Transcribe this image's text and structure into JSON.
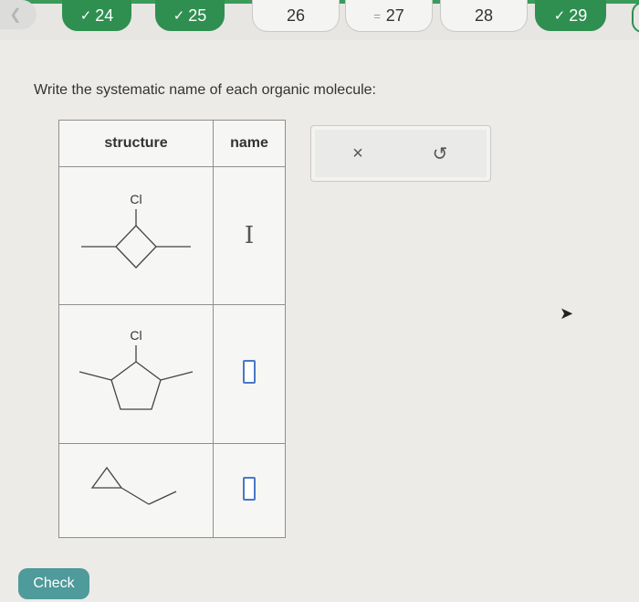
{
  "nav": {
    "back_icon": "chevron-left-icon",
    "questions": [
      {
        "label": "24",
        "status": "done"
      },
      {
        "label": "25",
        "status": "done"
      },
      {
        "label": "26",
        "status": "todo"
      },
      {
        "label": "27",
        "status": "current"
      },
      {
        "label": "28",
        "status": "todo"
      },
      {
        "label": "29",
        "status": "done"
      }
    ],
    "check_glyph": "✓",
    "current_glyph": "="
  },
  "prompt": "Write the systematic name of each organic molecule:",
  "table": {
    "headers": {
      "structure": "structure",
      "name": "name"
    },
    "rows": [
      {
        "atom_label": "Cl",
        "structure": "chlorocyclobutane-with-substituents",
        "answer": ""
      },
      {
        "atom_label": "Cl",
        "structure": "chlorocyclopentane-with-substituents",
        "answer": ""
      },
      {
        "atom_label": "",
        "structure": "cyclopropyl-propane",
        "answer": ""
      }
    ]
  },
  "tools": {
    "clear_glyph": "×",
    "undo_glyph": "↺"
  },
  "buttons": {
    "check": "Check"
  },
  "colors": {
    "accent_green": "#2f8f51",
    "check_button": "#4f9a9a",
    "answer_box_border": "#4a78c8"
  }
}
